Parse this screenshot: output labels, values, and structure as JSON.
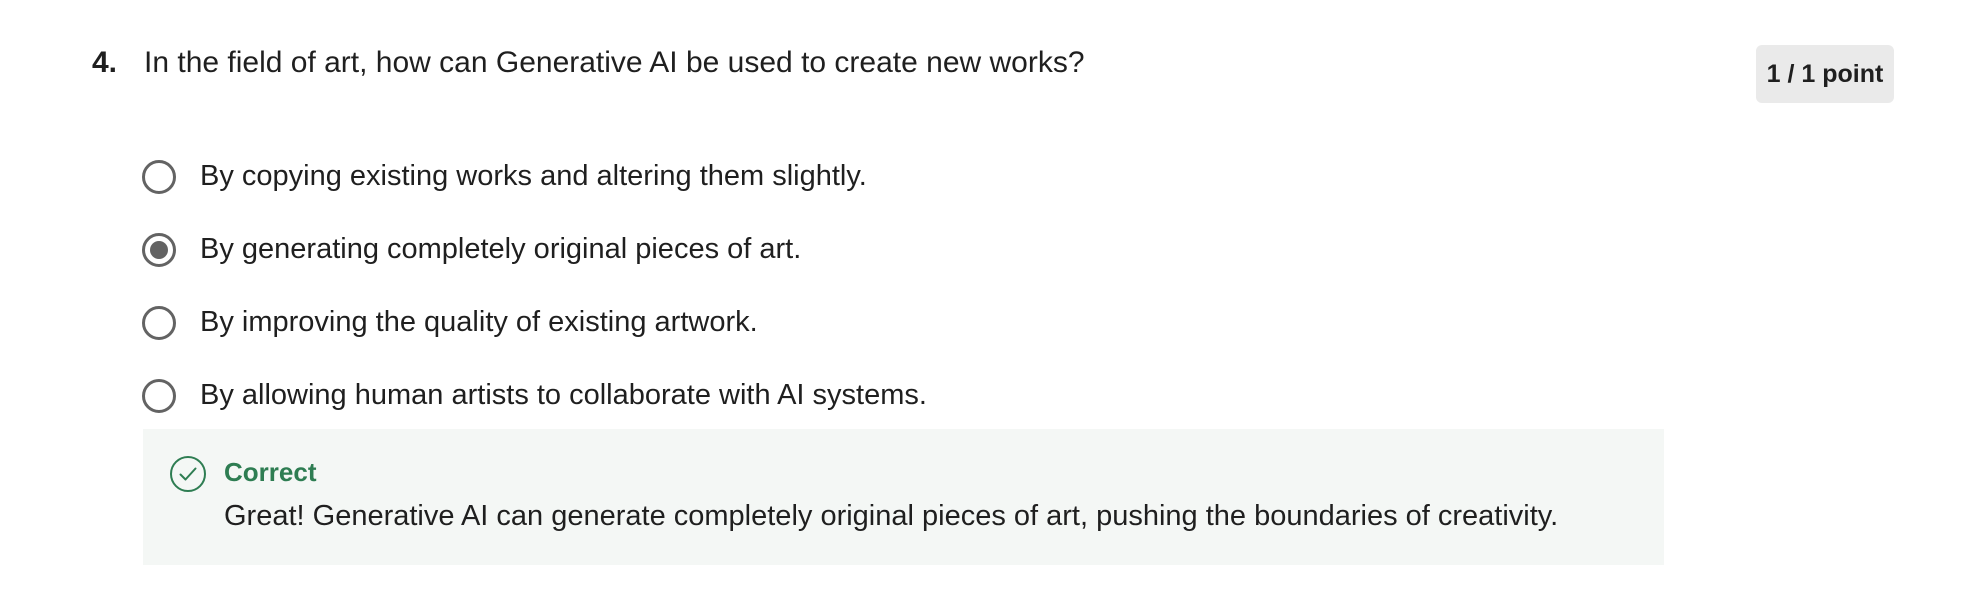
{
  "question": {
    "number": "4.",
    "text": "In the field of art, how can Generative AI be used to create new works?",
    "score": "1 / 1 point"
  },
  "options": [
    {
      "label": "By copying existing works and altering them slightly.",
      "selected": false
    },
    {
      "label": "By generating completely original pieces of art.",
      "selected": true
    },
    {
      "label": "By improving the quality of existing artwork.",
      "selected": false
    },
    {
      "label": "By allowing human artists to collaborate with AI systems.",
      "selected": false
    }
  ],
  "feedback": {
    "icon": "check-circle-icon",
    "title": "Correct",
    "text": "Great! Generative AI can generate completely original pieces of art, pushing the boundaries of creativity."
  },
  "colors": {
    "correct_green": "#2e7d52",
    "feedback_bg": "#f4f7f5",
    "radio_gray": "#636363",
    "badge_bg": "#eaeaea"
  }
}
